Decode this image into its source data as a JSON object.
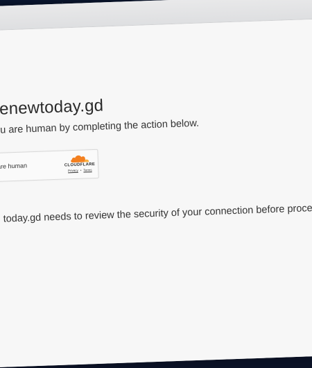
{
  "page": {
    "title": "enewtoday.gd",
    "subtitle": "u are human by completing the action below.",
    "body": "today.gd needs to review the security of your connection before procee"
  },
  "widget": {
    "label": "you are human",
    "brand": "CLOUDFLARE",
    "privacy_link": "Privacy",
    "separator": "•",
    "terms_link": "Terms"
  },
  "colors": {
    "cloudflare_orange": "#f38020",
    "cloudflare_light_orange": "#faae40",
    "page_background": "#f7f7f7",
    "text": "#333333"
  }
}
